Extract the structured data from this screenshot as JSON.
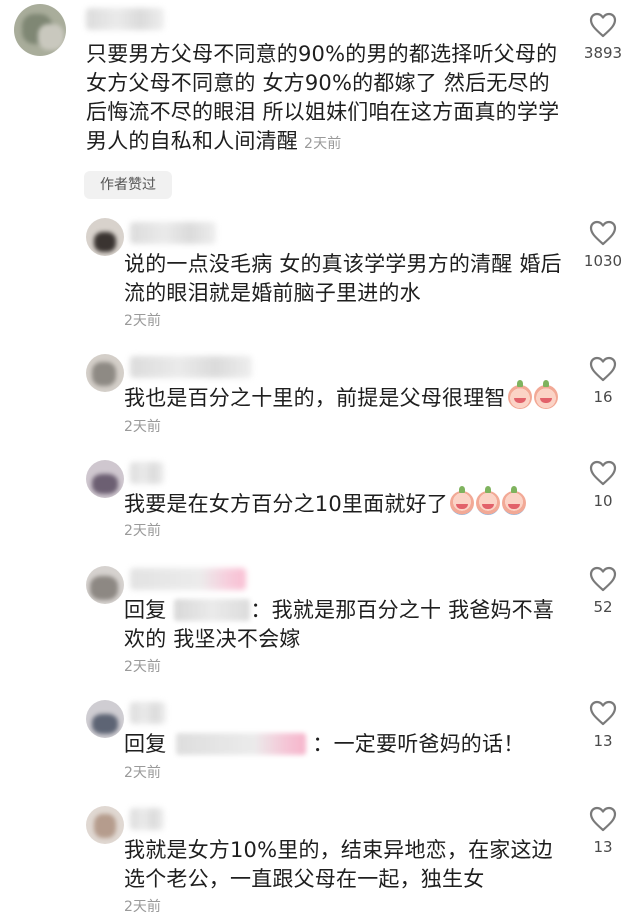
{
  "author_badge": "作者赞过",
  "comments": [
    {
      "text": "只要男方父母不同意的90%的男的都选择听父母的女方父母不同意的 女方90%的都嫁了 然后无尽的后悔流不尽的眼泪 所以姐妹们咱在这方面真的学学男人的自私和人间清醒",
      "time": "2天前",
      "likes": "3893"
    },
    {
      "text": "说的一点没毛病 女的真该学学男方的清醒 婚后流的眼泪就是婚前脑子里进的水",
      "time": "2天前",
      "likes": "1030"
    },
    {
      "text": "我也是百分之十里的，前提是父母很理智",
      "emoji": [
        "smile-emoji",
        "smile-emoji"
      ],
      "time": "2天前",
      "likes": "16"
    },
    {
      "text": "我要是在女方百分之10里面就好了",
      "emoji": [
        "cry-emoji",
        "cry-emoji",
        "cry-emoji"
      ],
      "time": "2天前",
      "likes": "10"
    },
    {
      "reply_prefix": "回复",
      "text": "：我就是那百分之十 我爸妈不喜欢的 我坚决不会嫁",
      "time": "2天前",
      "likes": "52"
    },
    {
      "reply_prefix": "回复",
      "text": "：一定要听爸妈的话！",
      "time": "2天前",
      "likes": "13"
    },
    {
      "text": "我就是女方10%里的，结束异地恋，在家这边选个老公，一直跟父母在一起，独生女",
      "time": "2天前",
      "likes": "13"
    }
  ],
  "icons": {
    "like": "heart-outline-icon"
  }
}
